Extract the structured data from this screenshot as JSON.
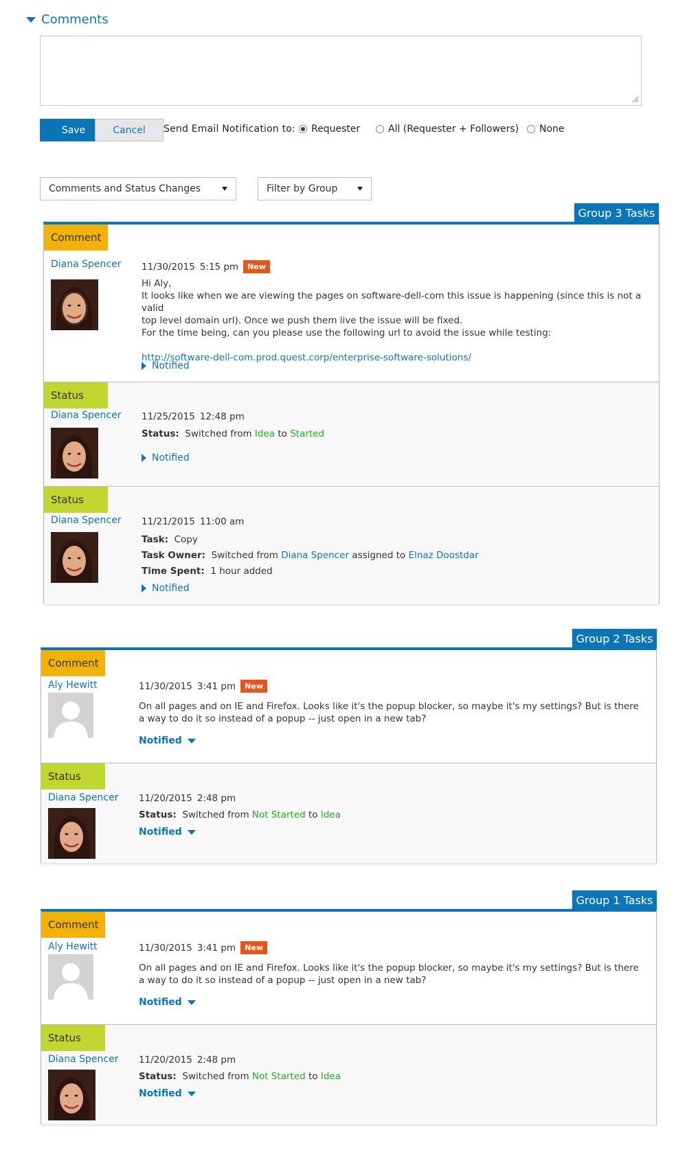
{
  "comments": {
    "title": "Comments",
    "textarea_value": "",
    "save_label": "Save",
    "cancel_label": "Cancel",
    "notify_label": "Send Email Notification to:",
    "radio_options": [
      {
        "label": "Requester",
        "checked": true
      },
      {
        "label": "All (Requester + Followers)",
        "checked": false
      },
      {
        "label": "None",
        "checked": false
      }
    ]
  },
  "filters": {
    "type_select": "Comments and Status Changes",
    "group_select": "Filter by Group"
  },
  "groups": [
    {
      "title": "Group 3 Tasks",
      "entries": [
        {
          "badge": "Comment",
          "author": "Diana Spencer",
          "date": "11/30/2015",
          "time": "5:15 pm",
          "new": "New",
          "lines": [
            "Hi Aly,",
            "It looks like when we are viewing the pages on software-dell-com this issue is happening (since this is not a valid",
            "top level domain url). Once we push them live the issue will be fixed.",
            "For the time being, can you please use the following url to avoid the issue while testing:"
          ],
          "link": "http://software-dell-com.prod.quest.corp/enterprise-software-solutions/",
          "notified": "Notified"
        },
        {
          "badge": "Status",
          "author": "Diana Spencer",
          "date": "11/25/2015",
          "time": "12:48 pm",
          "status_label": "Status:",
          "switched_from": "Switched from",
          "from": "Idea",
          "to_word": "to",
          "to": "Started",
          "notified": "Notified"
        },
        {
          "badge": "Status",
          "author": "Diana Spencer",
          "date": "11/21/2015",
          "time": "11:00 am",
          "task_label": "Task:",
          "task_value": "Copy",
          "owner_label": "Task Owner:",
          "owner_switched": "Switched from",
          "owner_from": "Diana Spencer",
          "owner_assigned": "assigned to",
          "owner_to": "Elnaz Doostdar",
          "time_label": "Time Spent:",
          "time_value": "1 hour added",
          "notified": "Notified"
        }
      ]
    },
    {
      "title": "Group 2 Tasks",
      "entries": [
        {
          "badge": "Comment",
          "author": "Aly Hewitt",
          "date": "11/30/2015",
          "time": "3:41 pm",
          "new": "New",
          "lines": [
            "On all pages and on IE and Firefox. Looks like it's the popup blocker, so maybe it's my settings? But is there",
            "a way to do it so instead of a popup -- just open in a new tab?"
          ],
          "notified": "Notified"
        },
        {
          "badge": "Status",
          "author": "Diana Spencer",
          "date": "11/20/2015",
          "time": "2:48 pm",
          "status_label": "Status:",
          "switched_from": "Switched from",
          "from": "Not Started",
          "to_word": "to",
          "to": "Idea",
          "notified": "Notified"
        }
      ]
    },
    {
      "title": "Group 1 Tasks",
      "entries": [
        {
          "badge": "Comment",
          "author": "Aly Hewitt",
          "date": "11/30/2015",
          "time": "3:41 pm",
          "new": "New",
          "lines": [
            "On all pages and on IE and Firefox. Looks like it's the popup blocker, so maybe it's my settings? But is there",
            "a way to do it so instead of a popup -- just open in a new tab?"
          ],
          "notified": "Notified"
        },
        {
          "badge": "Status",
          "author": "Diana Spencer",
          "date": "11/20/2015",
          "time": "2:48 pm",
          "status_label": "Status:",
          "switched_from": "Switched from",
          "from": "Not Started",
          "to_word": "to",
          "to": "Idea",
          "notified": "Notified"
        }
      ]
    }
  ]
}
